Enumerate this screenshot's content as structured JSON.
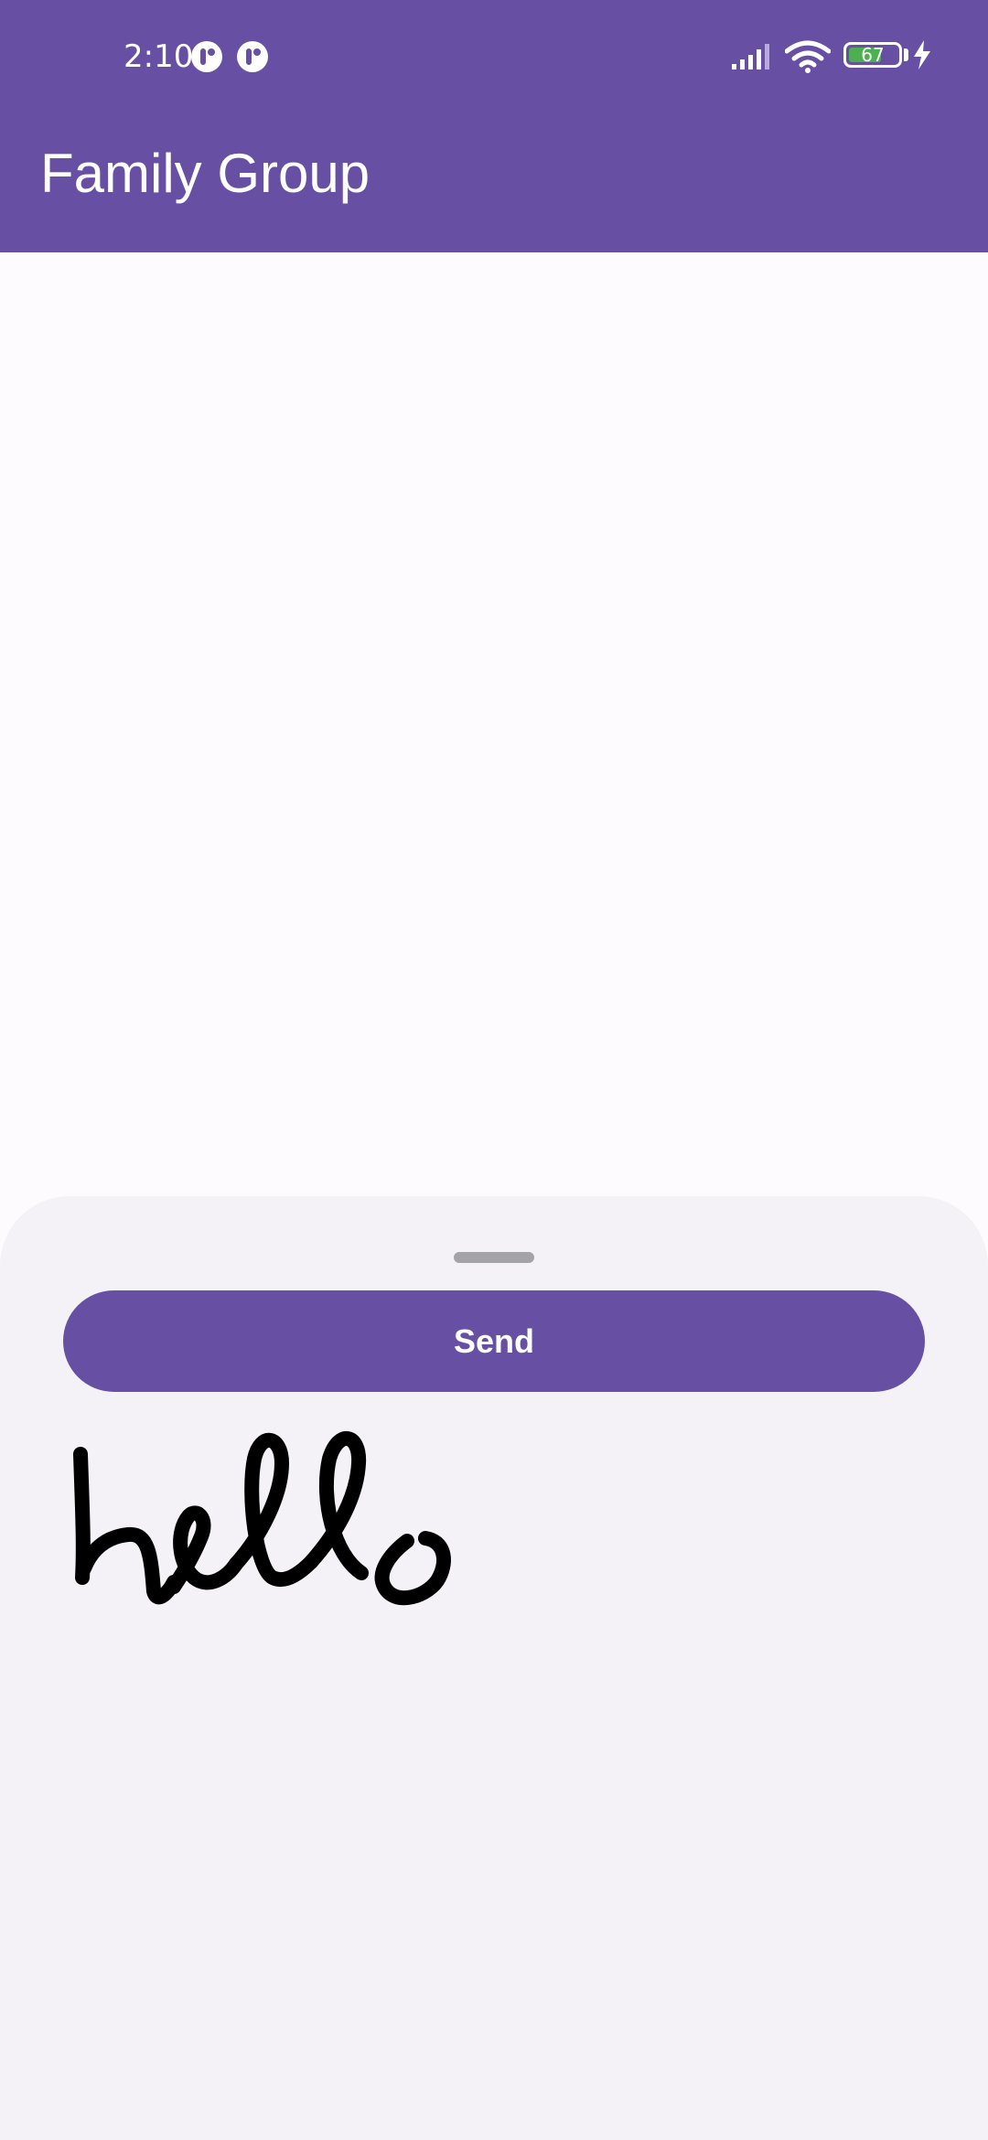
{
  "status_bar": {
    "time": "2:10",
    "battery_level": "67",
    "battery_fraction": 0.67,
    "icons": [
      "notification-icon",
      "notification-icon",
      "signal-icon",
      "wifi-icon",
      "battery-icon",
      "charging-bolt-icon"
    ]
  },
  "app_bar": {
    "title": "Family Group",
    "color": "#6750a4"
  },
  "bottom_sheet": {
    "send_label": "Send",
    "background": "#f4f1f7"
  },
  "drawing": {
    "stroke_color": "#000000"
  }
}
